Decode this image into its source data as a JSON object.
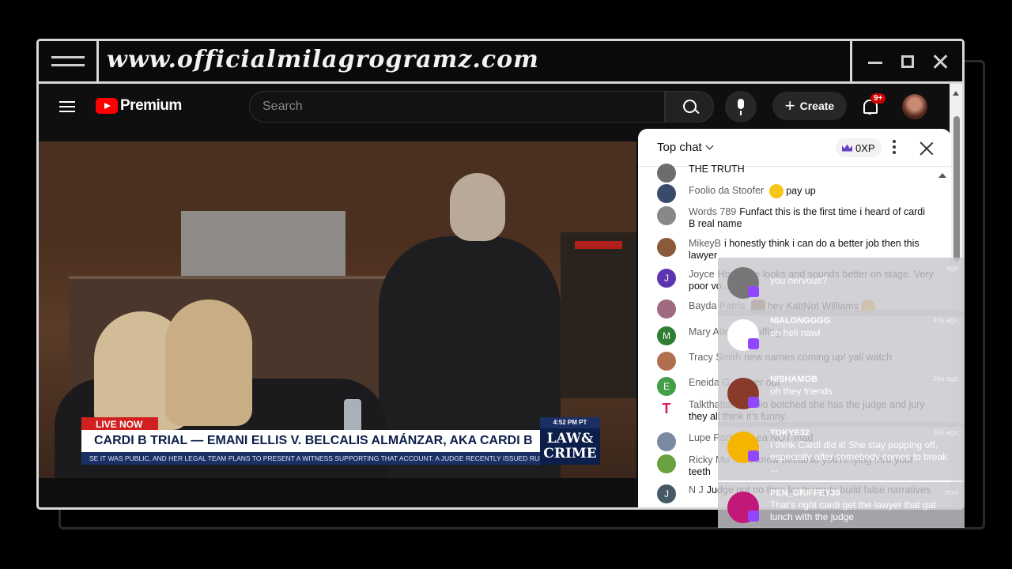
{
  "window": {
    "site_title": "www.officialmilagrogramz.com"
  },
  "youtube": {
    "logo_text": "Premium",
    "search_placeholder": "Search",
    "create_label": "Create",
    "notification_count": "9+"
  },
  "video": {
    "live_label": "LIVE NOW",
    "headline": "CARDI B TRIAL — EMANI ELLIS V. BELCALIS ALMÁNZAR, AKA CARDI B",
    "ticker": "SE IT WAS PUBLIC, AND HER LEGAL TEAM PLANS TO PRESENT A WITNESS SUPPORTING THAT ACCOUNT. A JUDGE RECENTLY ISSUED RULING",
    "time": "4:52 PM PT",
    "network_logo_line1": "LAW&",
    "network_logo_line2": "CRIME"
  },
  "chat": {
    "header_label": "Top chat",
    "xp_label": "0XP",
    "messages": [
      {
        "author": "",
        "text": "THE TRUTH",
        "avatar_letter": "",
        "avatar_color": "#6d6d6d"
      },
      {
        "author": "Foolio da Stoofer",
        "text": "pay up",
        "avatar_letter": "",
        "avatar_color": "#3a4a6a"
      },
      {
        "author": "Words 789",
        "text": "Funfact this is the first time i heard of cardi B real name",
        "avatar_letter": "",
        "avatar_color": "#888888"
      },
      {
        "author": "MikeyB",
        "text": "i honestly think i can do a better job then this lawyer",
        "avatar_letter": "",
        "avatar_color": "#8a5a3a"
      },
      {
        "author": "Joyce",
        "text": "Hope she looks and sounds better on stage. Very poor vo... skills.",
        "avatar_letter": "J",
        "avatar_color": "#5e35b1"
      },
      {
        "author": "Bayda Parris",
        "text": "hey KattNot Williams",
        "avatar_letter": "",
        "avatar_color": "#a06a80"
      },
      {
        "author": "Mary Alle...",
        "text": "he laffing",
        "avatar_letter": "M",
        "avatar_color": "#2e7d32"
      },
      {
        "author": "Tracy Smith",
        "text": "new names coming up! yall watch",
        "avatar_letter": "",
        "avatar_color": "#b07050"
      },
      {
        "author": "Eneida G...",
        "text": "...yer out",
        "avatar_letter": "E",
        "avatar_color": "#43a047"
      },
      {
        "author": "Talkthattalk",
        "text": "Foolio botched she has the judge and jury they all think it's funny.",
        "avatar_letter": "T",
        "avatar_color": "#ffffff"
      },
      {
        "author": "Lupe Parte...",
        "text": "...ea NOT mad",
        "avatar_letter": "",
        "avatar_color": "#7a8aa0"
      },
      {
        "author": "Ricky Mu...",
        "text": "we know because you're lying thru your teeth",
        "avatar_letter": "",
        "avatar_color": "#6aa040"
      },
      {
        "author": "N J",
        "text": "Judge got no time for trying to build false narratives",
        "avatar_letter": "J",
        "avatar_color": "#455a64"
      }
    ]
  },
  "overlay": [
    {
      "name": "",
      "text": "you nervous?",
      "ago": "ago",
      "avatar_color": "#777777"
    },
    {
      "name": "NIALONGGGG",
      "text": "oh hell nawl",
      "ago": "40s ago",
      "avatar_color": "#ffffff"
    },
    {
      "name": "NISHAMOB",
      "text": "oh they friends",
      "ago": "35s ago",
      "avatar_color": "#8a3a2a"
    },
    {
      "name": "TOKYE32",
      "text": "I think Cardi did it! She stay popping off, especially after somebody comes to break ...",
      "ago": "35s ago",
      "avatar_color": "#f5b400"
    },
    {
      "name": "PEN_GRIFFEY30",
      "text": "That's right cardi get the lawyer that gat lunch with the judge",
      "ago": "now",
      "avatar_color": "#c2187a"
    }
  ]
}
